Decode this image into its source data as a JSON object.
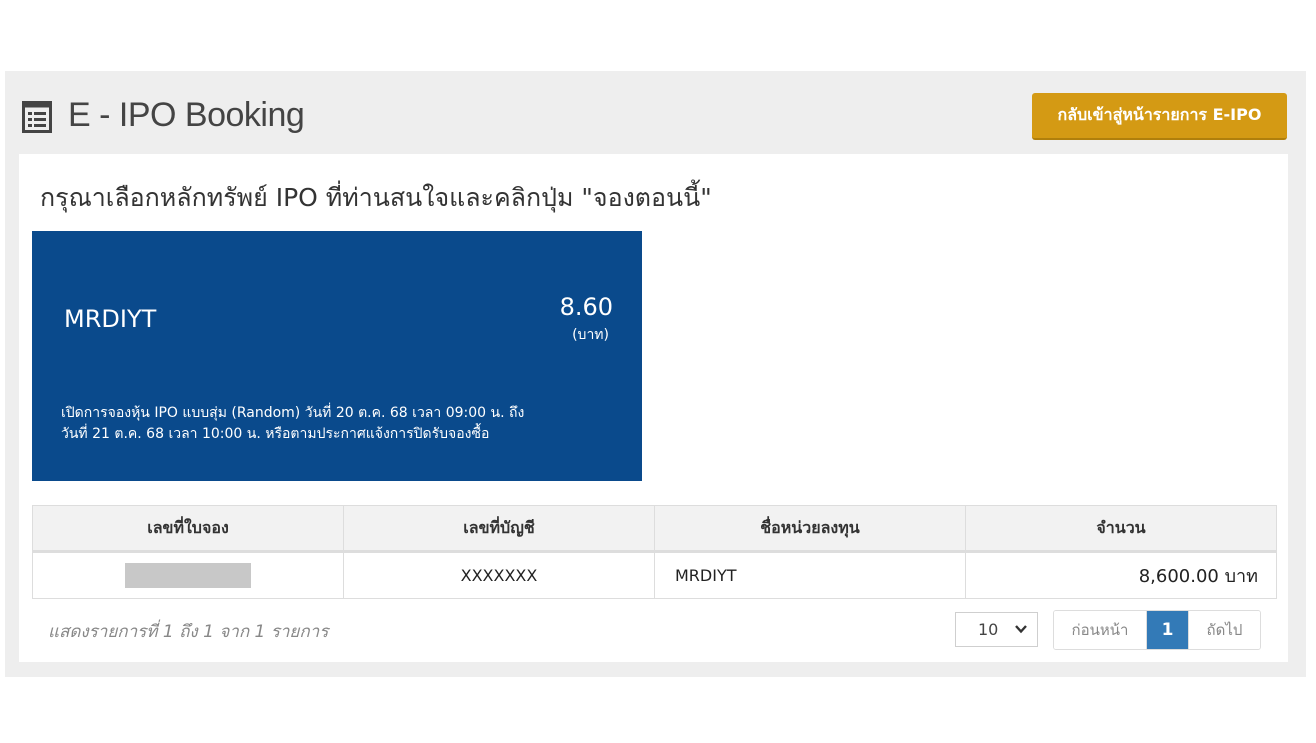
{
  "header": {
    "title": "E - IPO Booking",
    "back_button_label": "กลับเข้าสู่หน้ารายการ E-IPO"
  },
  "instruction": "กรุณาเลือกหลักทรัพย์ IPO ที่ท่านสนใจและคลิกปุ่ม \"จองตอนนี้\"",
  "ipo_card": {
    "symbol": "MRDIYT",
    "price": "8.60",
    "price_unit": "(บาท)",
    "description_line1": "เปิดการจองหุ้น IPO แบบสุ่ม (Random) วันที่ 20 ต.ค. 68 เวลา 09:00 น. ถึง",
    "description_line2": "วันที่ 21 ต.ค. 68 เวลา 10:00 น. หรือตามประกาศแจ้งการปิดรับจองซื้อ",
    "background_color": "#0a4a8c"
  },
  "table": {
    "headers": [
      "เลขที่ใบจอง",
      "เลขที่บัญชี",
      "ชื่อหน่วยลงทุน",
      "จำนวน"
    ],
    "rows": [
      {
        "booking_no": "",
        "account_no": "XXXXXXX",
        "fund_name": "MRDIYT",
        "amount": "8,600.00 บาท"
      }
    ]
  },
  "footer": {
    "info": "แสดงรายการที่ 1 ถึง 1 จาก 1 รายการ",
    "page_size": "10",
    "prev_label": "ก่อนหน้า",
    "current_page": "1",
    "next_label": "ถัดไป"
  },
  "colors": {
    "accent_button": "#d49a14",
    "active_page": "#337ab7"
  },
  "icons": {
    "header_icon": "list-icon",
    "page_size_icon": "chevron-down-icon"
  }
}
